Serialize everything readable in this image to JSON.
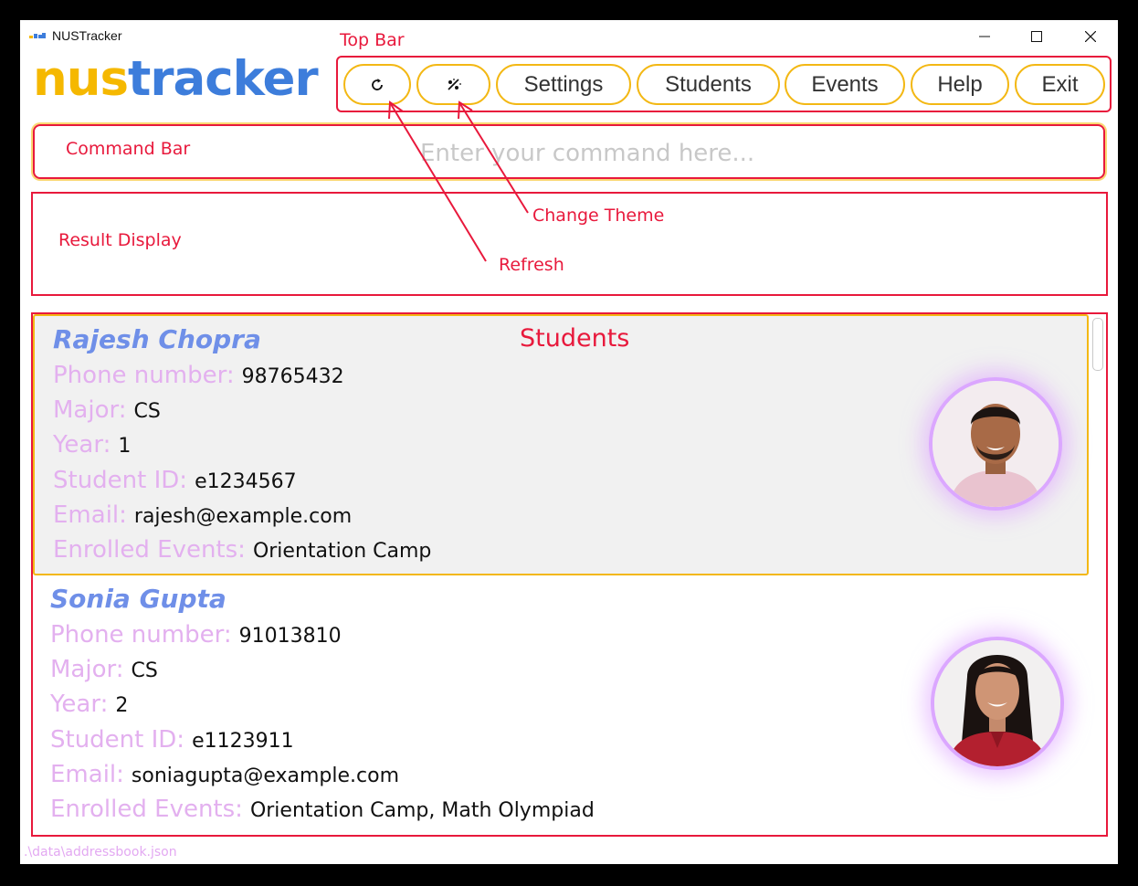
{
  "window": {
    "title": "NUSTracker"
  },
  "logo": {
    "part1": "nus",
    "part2": "tracker"
  },
  "toolbar": {
    "refresh_icon": "refresh-icon",
    "theme_icon": "theme-toggle-icon",
    "buttons": [
      "Settings",
      "Students",
      "Events",
      "Help",
      "Exit"
    ]
  },
  "command": {
    "placeholder": "Enter your command here..."
  },
  "annotations": {
    "top_bar": "Top Bar",
    "command_bar": "Command Bar",
    "result_display": "Result Display",
    "change_theme": "Change Theme",
    "refresh": "Refresh",
    "students": "Students"
  },
  "labels": {
    "phone": "Phone number:",
    "major": "Major:",
    "year": "Year:",
    "student_id": "Student ID:",
    "email": "Email:",
    "events": "Enrolled Events:"
  },
  "students": [
    {
      "name": "Rajesh Chopra",
      "phone": "98765432",
      "major": "CS",
      "year": "1",
      "student_id": "e1234567",
      "email": "rajesh@example.com",
      "events": "Orientation Camp"
    },
    {
      "name": "Sonia Gupta",
      "phone": "91013810",
      "major": "CS",
      "year": "2",
      "student_id": "e1123911",
      "email": "soniagupta@example.com",
      "events": "Orientation Camp, Math Olympiad"
    }
  ],
  "status_bar": {
    "path": ".\\data\\addressbook.json"
  },
  "colors": {
    "accent": "#f3b814",
    "annotation": "#e8193c",
    "name": "#6f8fe8",
    "label": "#e3b0ef",
    "logo_nus": "#f5b800",
    "logo_tracker": "#3d7ddb"
  }
}
